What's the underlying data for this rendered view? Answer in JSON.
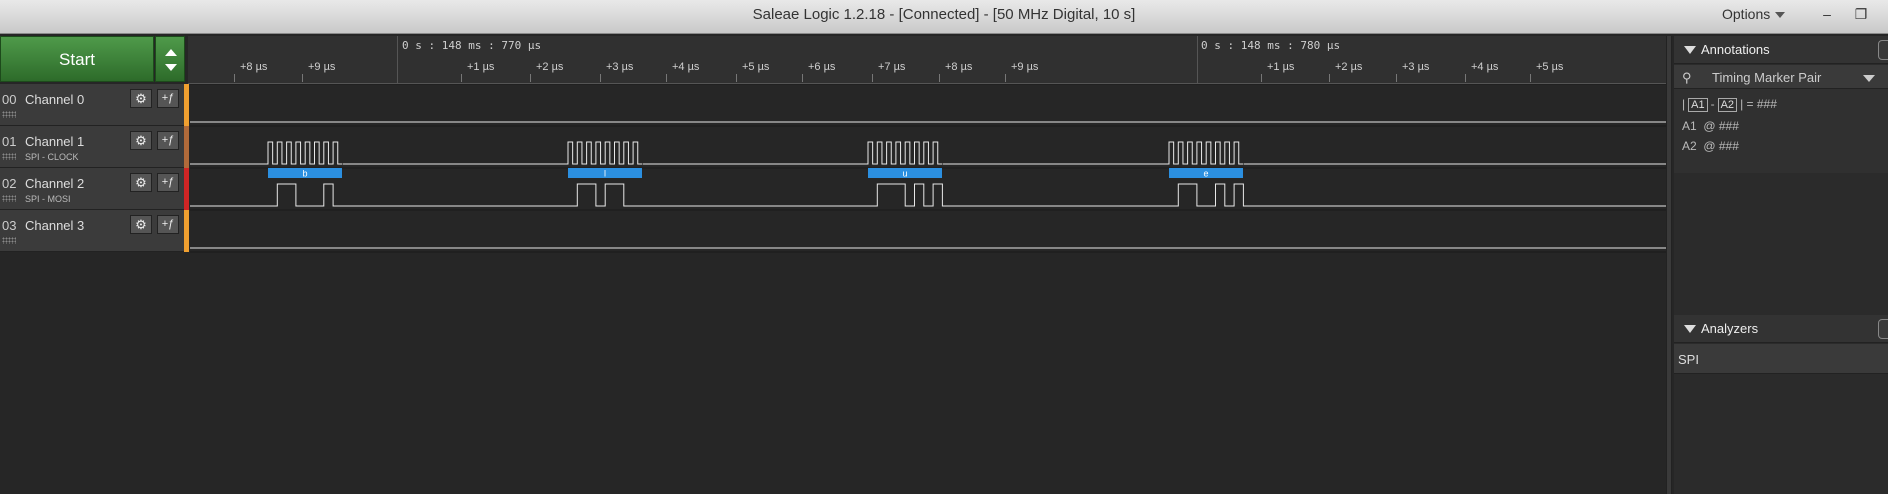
{
  "window": {
    "title": "Saleae Logic 1.2.18 - [Connected] - [50 MHz Digital, 10 s]",
    "options_label": "Options",
    "minimize_glyph": "–",
    "restore_glyph": "❐"
  },
  "start_button": {
    "label": "Start"
  },
  "ruler": {
    "timestamp_left": "0 s : 148 ms : 770 µs",
    "timestamp_right": "0 s : 148 ms : 780 µs",
    "ticks": [
      "+8 µs",
      "+9 µs",
      "+1 µs",
      "+2 µs",
      "+3 µs",
      "+4 µs",
      "+5 µs",
      "+6 µs",
      "+7 µs",
      "+8 µs",
      "+9 µs",
      "+1 µs",
      "+2 µs",
      "+3 µs",
      "+4 µs",
      "+5 µs"
    ]
  },
  "channels": [
    {
      "num": "00",
      "name": "Channel 0",
      "sub": "",
      "color": "#f0a030"
    },
    {
      "num": "01",
      "name": "Channel 1",
      "sub": "SPI - CLOCK",
      "color": "#b06a3a"
    },
    {
      "num": "02",
      "name": "Channel 2",
      "sub": "SPI - MOSI",
      "color": "#d02525"
    },
    {
      "num": "03",
      "name": "Channel 3",
      "sub": "",
      "color": "#f0a030"
    }
  ],
  "channel_buttons": {
    "gear_glyph": "⚙",
    "trigger_glyph": "+ƒ"
  },
  "decoded_bytes": [
    "b",
    "l",
    "u",
    "e"
  ],
  "annotations": {
    "header": "Annotations",
    "marker_pair": "Timing Marker Pair",
    "pin_glyph": "⚲",
    "delta_label_a": "A1",
    "delta_label_b": "A2",
    "delta_value": "= ###",
    "a1_label": "A1",
    "a1_value": "@ ###",
    "a2_label": "A2",
    "a2_value": "@ ###"
  },
  "analyzers": {
    "header": "Analyzers",
    "items": [
      "SPI"
    ]
  },
  "colors": {
    "start_green": "#3d8a38",
    "decode_blue": "#2b8fe0",
    "wave_line": "#e8e8e8"
  }
}
